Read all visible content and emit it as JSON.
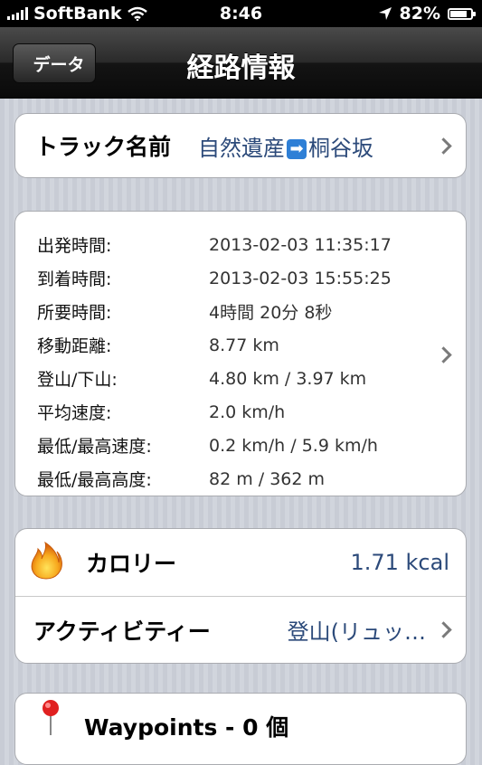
{
  "status_bar": {
    "carrier": "SoftBank",
    "time": "8:46",
    "battery": "82%",
    "battery_level": 0.82
  },
  "nav": {
    "back_label": "データ",
    "title": "経路情報"
  },
  "track": {
    "label": "トラック名前",
    "value_before": "自然遺産",
    "value_after": "桐谷坂",
    "arrow_glyph": "➡"
  },
  "details": [
    {
      "label": "出発時間:",
      "value": "2013-02-03 11:35:17"
    },
    {
      "label": "到着時間:",
      "value": "2013-02-03 15:55:25"
    },
    {
      "label": "所要時間:",
      "value": "4時間 20分 8秒"
    },
    {
      "label": "移動距離:",
      "value": "8.77 km"
    },
    {
      "label": "登山/下山:",
      "value": "4.80 km / 3.97 km"
    },
    {
      "label": "平均速度:",
      "value": "2.0 km/h"
    },
    {
      "label": "最低/最高速度:",
      "value": "0.2 km/h / 5.9 km/h"
    },
    {
      "label": "最低/最高高度:",
      "value": "82 m / 362 m"
    }
  ],
  "calorie": {
    "label": "カロリー",
    "value": "1.71 kcal"
  },
  "activity": {
    "label": "アクティビティー",
    "value": "登山(リュッ…"
  },
  "waypoints": {
    "label": "Waypoints - 0 個"
  },
  "colors": {
    "accent_blue": "#2c4a7a",
    "background_stripe": "#c8ccd5"
  },
  "icons": [
    "signal-bars-icon",
    "wifi-icon",
    "location-arrow-icon",
    "battery-icon",
    "chevron-right-icon",
    "flame-icon",
    "red-pin-icon"
  ]
}
